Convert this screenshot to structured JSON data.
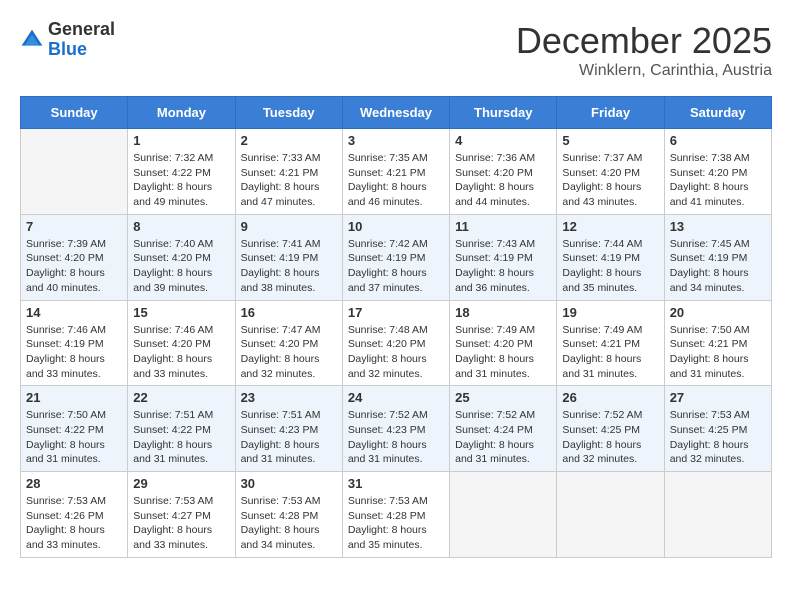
{
  "logo": {
    "general": "General",
    "blue": "Blue"
  },
  "title": "December 2025",
  "subtitle": "Winklern, Carinthia, Austria",
  "days_of_week": [
    "Sunday",
    "Monday",
    "Tuesday",
    "Wednesday",
    "Thursday",
    "Friday",
    "Saturday"
  ],
  "weeks": [
    [
      {
        "day": "",
        "info": ""
      },
      {
        "day": "1",
        "info": "Sunrise: 7:32 AM\nSunset: 4:22 PM\nDaylight: 8 hours\nand 49 minutes."
      },
      {
        "day": "2",
        "info": "Sunrise: 7:33 AM\nSunset: 4:21 PM\nDaylight: 8 hours\nand 47 minutes."
      },
      {
        "day": "3",
        "info": "Sunrise: 7:35 AM\nSunset: 4:21 PM\nDaylight: 8 hours\nand 46 minutes."
      },
      {
        "day": "4",
        "info": "Sunrise: 7:36 AM\nSunset: 4:20 PM\nDaylight: 8 hours\nand 44 minutes."
      },
      {
        "day": "5",
        "info": "Sunrise: 7:37 AM\nSunset: 4:20 PM\nDaylight: 8 hours\nand 43 minutes."
      },
      {
        "day": "6",
        "info": "Sunrise: 7:38 AM\nSunset: 4:20 PM\nDaylight: 8 hours\nand 41 minutes."
      }
    ],
    [
      {
        "day": "7",
        "info": "Sunrise: 7:39 AM\nSunset: 4:20 PM\nDaylight: 8 hours\nand 40 minutes."
      },
      {
        "day": "8",
        "info": "Sunrise: 7:40 AM\nSunset: 4:20 PM\nDaylight: 8 hours\nand 39 minutes."
      },
      {
        "day": "9",
        "info": "Sunrise: 7:41 AM\nSunset: 4:19 PM\nDaylight: 8 hours\nand 38 minutes."
      },
      {
        "day": "10",
        "info": "Sunrise: 7:42 AM\nSunset: 4:19 PM\nDaylight: 8 hours\nand 37 minutes."
      },
      {
        "day": "11",
        "info": "Sunrise: 7:43 AM\nSunset: 4:19 PM\nDaylight: 8 hours\nand 36 minutes."
      },
      {
        "day": "12",
        "info": "Sunrise: 7:44 AM\nSunset: 4:19 PM\nDaylight: 8 hours\nand 35 minutes."
      },
      {
        "day": "13",
        "info": "Sunrise: 7:45 AM\nSunset: 4:19 PM\nDaylight: 8 hours\nand 34 minutes."
      }
    ],
    [
      {
        "day": "14",
        "info": "Sunrise: 7:46 AM\nSunset: 4:19 PM\nDaylight: 8 hours\nand 33 minutes."
      },
      {
        "day": "15",
        "info": "Sunrise: 7:46 AM\nSunset: 4:20 PM\nDaylight: 8 hours\nand 33 minutes."
      },
      {
        "day": "16",
        "info": "Sunrise: 7:47 AM\nSunset: 4:20 PM\nDaylight: 8 hours\nand 32 minutes."
      },
      {
        "day": "17",
        "info": "Sunrise: 7:48 AM\nSunset: 4:20 PM\nDaylight: 8 hours\nand 32 minutes."
      },
      {
        "day": "18",
        "info": "Sunrise: 7:49 AM\nSunset: 4:20 PM\nDaylight: 8 hours\nand 31 minutes."
      },
      {
        "day": "19",
        "info": "Sunrise: 7:49 AM\nSunset: 4:21 PM\nDaylight: 8 hours\nand 31 minutes."
      },
      {
        "day": "20",
        "info": "Sunrise: 7:50 AM\nSunset: 4:21 PM\nDaylight: 8 hours\nand 31 minutes."
      }
    ],
    [
      {
        "day": "21",
        "info": "Sunrise: 7:50 AM\nSunset: 4:22 PM\nDaylight: 8 hours\nand 31 minutes."
      },
      {
        "day": "22",
        "info": "Sunrise: 7:51 AM\nSunset: 4:22 PM\nDaylight: 8 hours\nand 31 minutes."
      },
      {
        "day": "23",
        "info": "Sunrise: 7:51 AM\nSunset: 4:23 PM\nDaylight: 8 hours\nand 31 minutes."
      },
      {
        "day": "24",
        "info": "Sunrise: 7:52 AM\nSunset: 4:23 PM\nDaylight: 8 hours\nand 31 minutes."
      },
      {
        "day": "25",
        "info": "Sunrise: 7:52 AM\nSunset: 4:24 PM\nDaylight: 8 hours\nand 31 minutes."
      },
      {
        "day": "26",
        "info": "Sunrise: 7:52 AM\nSunset: 4:25 PM\nDaylight: 8 hours\nand 32 minutes."
      },
      {
        "day": "27",
        "info": "Sunrise: 7:53 AM\nSunset: 4:25 PM\nDaylight: 8 hours\nand 32 minutes."
      }
    ],
    [
      {
        "day": "28",
        "info": "Sunrise: 7:53 AM\nSunset: 4:26 PM\nDaylight: 8 hours\nand 33 minutes."
      },
      {
        "day": "29",
        "info": "Sunrise: 7:53 AM\nSunset: 4:27 PM\nDaylight: 8 hours\nand 33 minutes."
      },
      {
        "day": "30",
        "info": "Sunrise: 7:53 AM\nSunset: 4:28 PM\nDaylight: 8 hours\nand 34 minutes."
      },
      {
        "day": "31",
        "info": "Sunrise: 7:53 AM\nSunset: 4:28 PM\nDaylight: 8 hours\nand 35 minutes."
      },
      {
        "day": "",
        "info": ""
      },
      {
        "day": "",
        "info": ""
      },
      {
        "day": "",
        "info": ""
      }
    ]
  ]
}
